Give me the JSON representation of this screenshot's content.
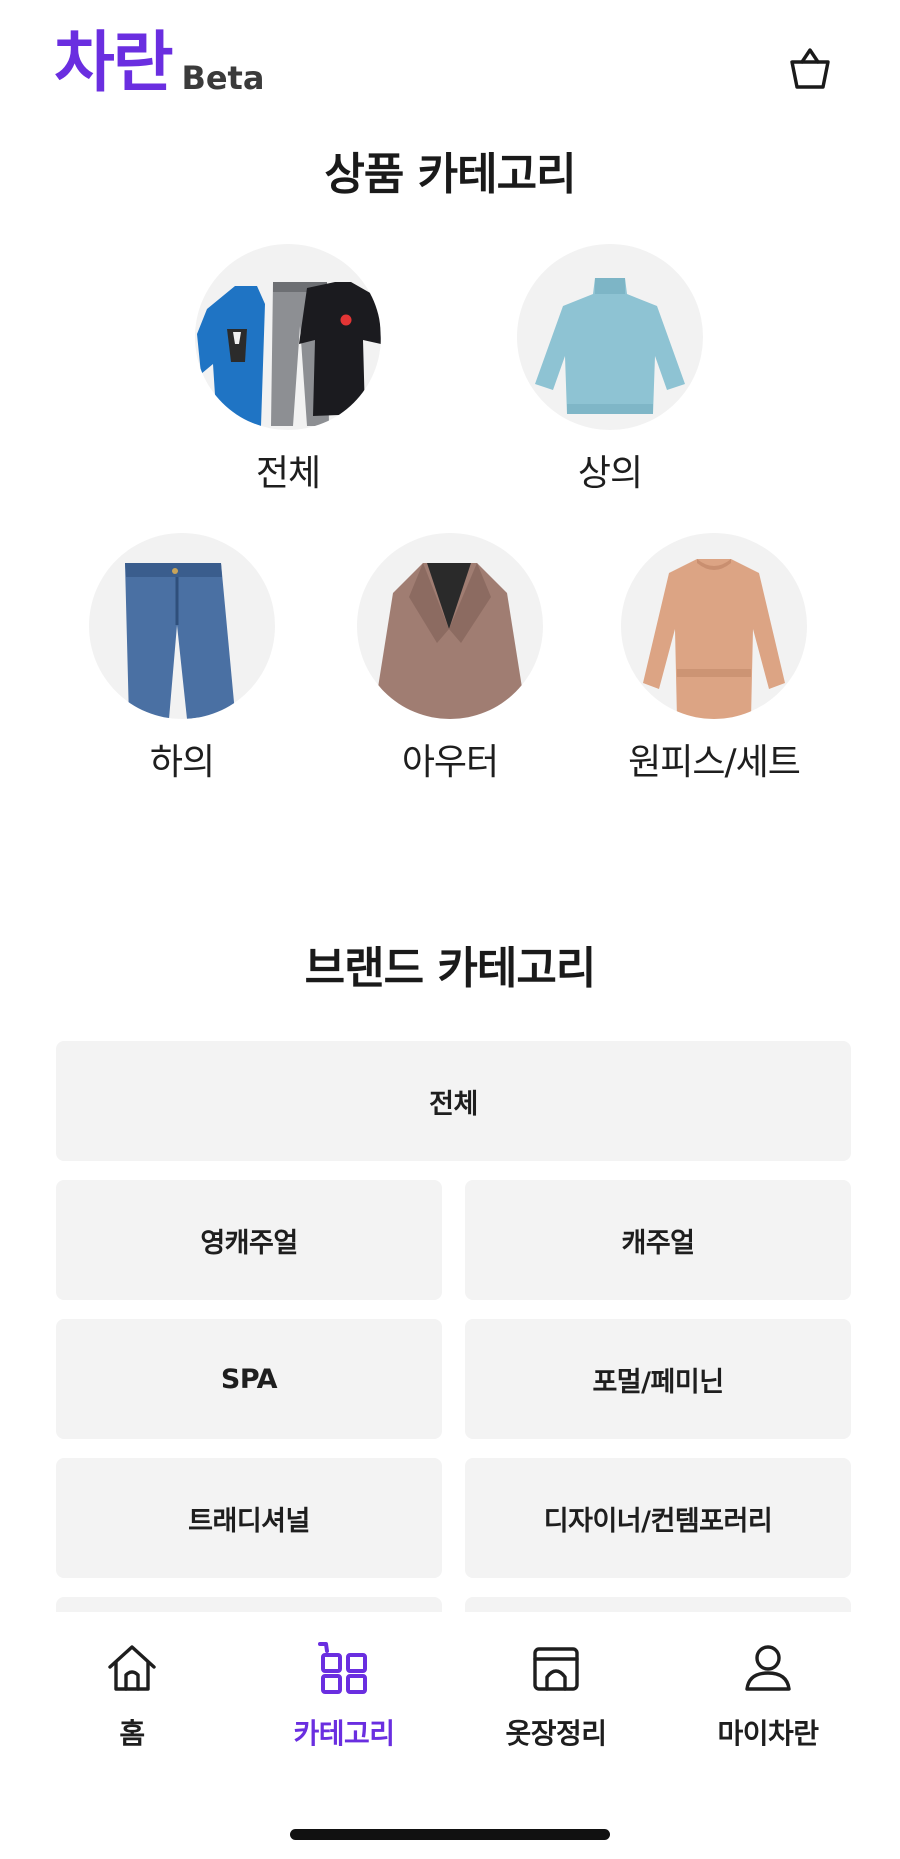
{
  "header": {
    "logo": "차란",
    "beta": "Beta",
    "cart_icon": "shopping-basket-icon"
  },
  "product_category": {
    "title": "상품 카테고리",
    "items": [
      {
        "label": "전체",
        "image": "clothes-bundle"
      },
      {
        "label": "상의",
        "image": "sky-blue-turtleneck-sweater"
      },
      {
        "label": "하의",
        "image": "blue-denim-jeans"
      },
      {
        "label": "아우터",
        "image": "brown-wool-coat"
      },
      {
        "label": "원피스/세트",
        "image": "peach-long-sleeve-dress"
      }
    ]
  },
  "brand_category": {
    "title": "브랜드 카테고리",
    "items": [
      {
        "label": "전체"
      },
      {
        "label": "영캐주얼"
      },
      {
        "label": "캐주얼"
      },
      {
        "label": "SPA"
      },
      {
        "label": "포멀/페미닌"
      },
      {
        "label": "트래디셔널"
      },
      {
        "label": "디자이너/컨템포러리"
      }
    ]
  },
  "bottom_nav": {
    "items": [
      {
        "label": "홈",
        "icon": "home-icon",
        "active": false
      },
      {
        "label": "카테고리",
        "icon": "category-grid-icon",
        "active": true
      },
      {
        "label": "옷장정리",
        "icon": "closet-box-icon",
        "active": false
      },
      {
        "label": "마이차란",
        "icon": "user-icon",
        "active": false
      }
    ]
  },
  "colors": {
    "brand_purple": "#6a2ee0",
    "button_gray": "#f3f3f3",
    "text_dark": "#1e1e1e"
  }
}
